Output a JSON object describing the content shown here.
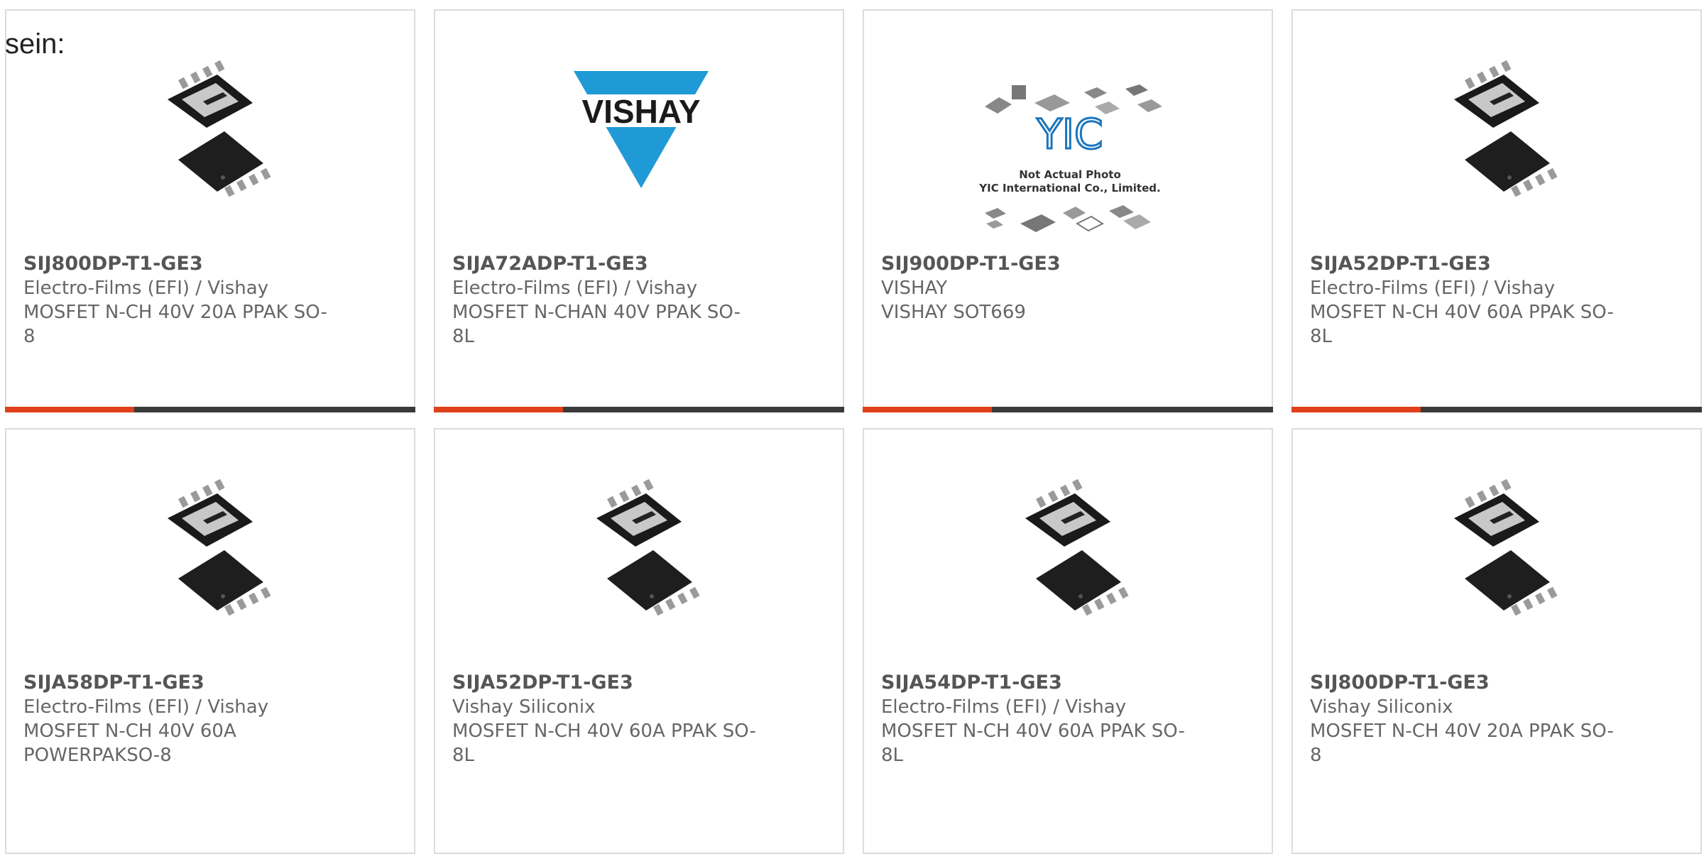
{
  "intro_text": "sein:",
  "products": [
    {
      "part": "SIJ800DP-T1-GE3",
      "maker": "Electro-Films (EFI) / Vishay",
      "desc1": "MOSFET N-CH 40V 20A PPAK SO-",
      "desc2": "8",
      "image": "mosfet-package"
    },
    {
      "part": "SIJA72ADP-T1-GE3",
      "maker": "Electro-Films (EFI) / Vishay",
      "desc1": "MOSFET N-CHAN 40V PPAK SO-",
      "desc2": "8L",
      "image": "vishay-logo",
      "logo_text": "VISHAY"
    },
    {
      "part": "SIJ900DP-T1-GE3",
      "maker": "VISHAY",
      "desc1": "VISHAY SOT669",
      "desc2": "",
      "image": "placeholder-photo",
      "placeholder_lines": [
        "Not Actual Photo",
        "YIC International Co., Limited."
      ],
      "placeholder_logo": "YIC"
    },
    {
      "part": "SIJA52DP-T1-GE3",
      "maker": "Electro-Films (EFI) / Vishay",
      "desc1": "MOSFET N-CH 40V 60A PPAK SO-",
      "desc2": "8L",
      "image": "mosfet-package"
    },
    {
      "part": "SIJA58DP-T1-GE3",
      "maker": "Electro-Films (EFI) / Vishay",
      "desc1": "MOSFET N-CH 40V 60A",
      "desc2": "POWERPAKSO-8",
      "image": "mosfet-package"
    },
    {
      "part": "SIJA52DP-T1-GE3",
      "maker": "Vishay Siliconix",
      "desc1": "MOSFET N-CH 40V 60A PPAK SO-",
      "desc2": "8L",
      "image": "mosfet-package"
    },
    {
      "part": "SIJA54DP-T1-GE3",
      "maker": "Electro-Films (EFI) / Vishay",
      "desc1": "MOSFET N-CH 40V 60A PPAK SO-",
      "desc2": "8L",
      "image": "mosfet-package"
    },
    {
      "part": "SIJ800DP-T1-GE3",
      "maker": "Vishay Siliconix",
      "desc1": "MOSFET N-CH 40V 20A PPAK SO-",
      "desc2": "8",
      "image": "mosfet-package"
    }
  ],
  "colors": {
    "accent": "#e0401a",
    "bar": "#3a3a3a",
    "vishay_blue": "#1f9ad6",
    "border": "#dcdcdc"
  }
}
